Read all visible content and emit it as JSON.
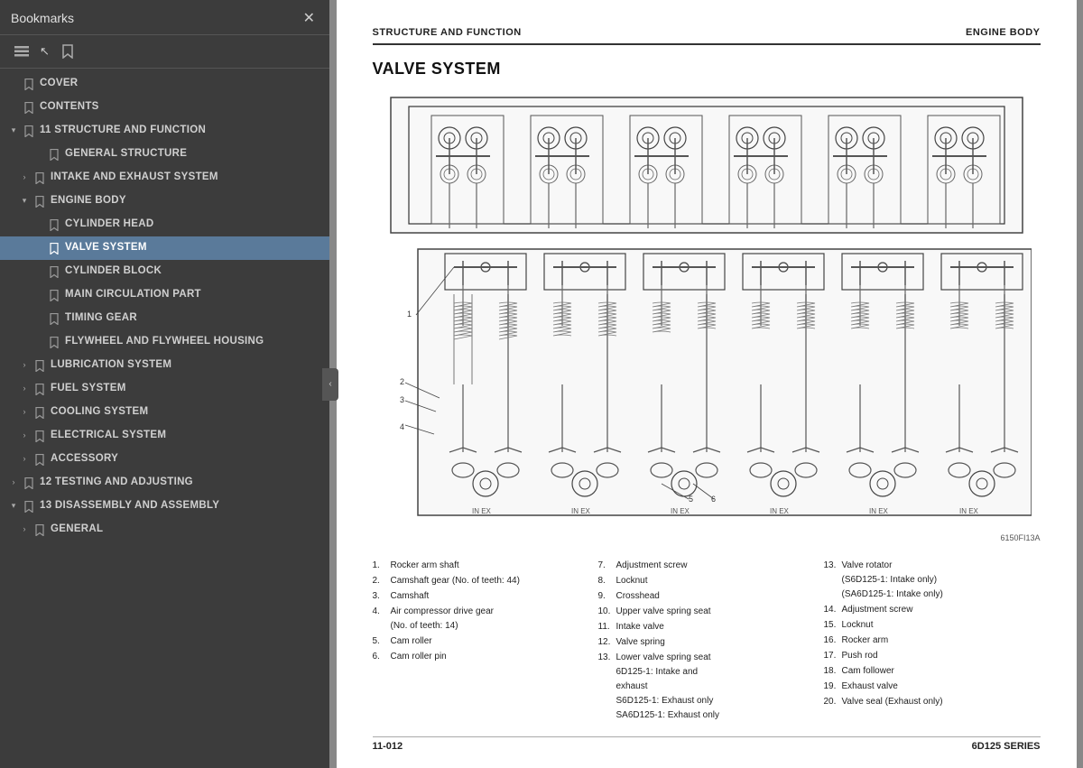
{
  "left_panel": {
    "title": "Bookmarks",
    "close_label": "✕",
    "toolbar": {
      "icon1": "☰",
      "icon2": "🔖",
      "cursor": "↖"
    },
    "tree": [
      {
        "id": "cover",
        "label": "COVER",
        "level": 0,
        "toggle": "",
        "hasBookmark": true,
        "active": false
      },
      {
        "id": "contents",
        "label": "CONTENTS",
        "level": 0,
        "toggle": "",
        "hasBookmark": true,
        "active": false
      },
      {
        "id": "struct-func",
        "label": "11 STRUCTURE AND FUNCTION",
        "level": 0,
        "toggle": "▾",
        "hasBookmark": true,
        "active": false
      },
      {
        "id": "gen-struct",
        "label": "GENERAL STRUCTURE",
        "level": 2,
        "toggle": "",
        "hasBookmark": true,
        "active": false
      },
      {
        "id": "intake-exhaust",
        "label": "INTAKE AND EXHAUST SYSTEM",
        "level": 1,
        "toggle": "›",
        "hasBookmark": true,
        "active": false
      },
      {
        "id": "engine-body",
        "label": "ENGINE BODY",
        "level": 1,
        "toggle": "▾",
        "hasBookmark": true,
        "active": false
      },
      {
        "id": "cyl-head",
        "label": "CYLINDER HEAD",
        "level": 2,
        "toggle": "",
        "hasBookmark": true,
        "active": false
      },
      {
        "id": "valve-system",
        "label": "VALVE SYSTEM",
        "level": 2,
        "toggle": "",
        "hasBookmark": true,
        "active": true
      },
      {
        "id": "cyl-block",
        "label": "CYLINDER BLOCK",
        "level": 2,
        "toggle": "",
        "hasBookmark": true,
        "active": false
      },
      {
        "id": "main-circ",
        "label": "MAIN CIRCULATION PART",
        "level": 2,
        "toggle": "",
        "hasBookmark": true,
        "active": false
      },
      {
        "id": "timing-gear",
        "label": "TIMING GEAR",
        "level": 2,
        "toggle": "",
        "hasBookmark": true,
        "active": false
      },
      {
        "id": "flywheel",
        "label": "FLYWHEEL AND FLYWHEEL HOUSING",
        "level": 2,
        "toggle": "",
        "hasBookmark": true,
        "active": false
      },
      {
        "id": "lubrication",
        "label": "LUBRICATION SYSTEM",
        "level": 1,
        "toggle": "›",
        "hasBookmark": true,
        "active": false
      },
      {
        "id": "fuel",
        "label": "FUEL SYSTEM",
        "level": 1,
        "toggle": "›",
        "hasBookmark": true,
        "active": false
      },
      {
        "id": "cooling",
        "label": "COOLING SYSTEM",
        "level": 1,
        "toggle": "›",
        "hasBookmark": true,
        "active": false
      },
      {
        "id": "electrical",
        "label": "ELECTRICAL SYSTEM",
        "level": 1,
        "toggle": "›",
        "hasBookmark": true,
        "active": false
      },
      {
        "id": "accessory",
        "label": "ACCESSORY",
        "level": 1,
        "toggle": "›",
        "hasBookmark": true,
        "active": false
      },
      {
        "id": "testing",
        "label": "12 TESTING AND ADJUSTING",
        "level": 0,
        "toggle": "›",
        "hasBookmark": true,
        "active": false
      },
      {
        "id": "disassembly",
        "label": "13 DISASSEMBLY AND ASSEMBLY",
        "level": 0,
        "toggle": "▾",
        "hasBookmark": true,
        "active": false
      },
      {
        "id": "general",
        "label": "GENERAL",
        "level": 1,
        "toggle": "›",
        "hasBookmark": true,
        "active": false
      }
    ]
  },
  "right_panel": {
    "header_left": "STRUCTURE AND FUNCTION",
    "header_right": "ENGINE BODY",
    "section_title": "VALVE SYSTEM",
    "diagram_code": "6150FI13A",
    "legend_col1": [
      {
        "num": "1.",
        "text": "Rocker arm shaft"
      },
      {
        "num": "2.",
        "text": "Camshaft gear (No. of teeth: 44)"
      },
      {
        "num": "3.",
        "text": "Camshaft"
      },
      {
        "num": "4.",
        "text": "Air compressor drive gear\n(No. of teeth: 14)"
      },
      {
        "num": "5.",
        "text": "Cam roller"
      },
      {
        "num": "6.",
        "text": "Cam roller pin"
      }
    ],
    "legend_col2": [
      {
        "num": "7.",
        "text": "Adjustment screw"
      },
      {
        "num": "8.",
        "text": "Locknut"
      },
      {
        "num": "9.",
        "text": "Crosshead"
      },
      {
        "num": "10.",
        "text": "Upper valve spring seat"
      },
      {
        "num": "11.",
        "text": "Intake valve"
      },
      {
        "num": "12.",
        "text": "Valve spring"
      },
      {
        "num": "13.",
        "text": "Lower valve spring seat\n6D125-1:  Intake and\n           exhaust\nS6D125-1: Exhaust only\nSA6D125-1: Exhaust only"
      }
    ],
    "legend_col3": [
      {
        "num": "13.",
        "text": "Valve rotator\n(S6D125-1:   Intake only)\n(SA6D125-1: Intake only)"
      },
      {
        "num": "14.",
        "text": "Adjustment screw"
      },
      {
        "num": "15.",
        "text": "Locknut"
      },
      {
        "num": "16.",
        "text": "Rocker arm"
      },
      {
        "num": "17.",
        "text": "Push rod"
      },
      {
        "num": "18.",
        "text": "Cam follower"
      },
      {
        "num": "19.",
        "text": "Exhaust valve"
      },
      {
        "num": "20.",
        "text": "Valve seal (Exhaust only)"
      }
    ],
    "page_number": "11-012",
    "series": "6D125 SERIES",
    "collapse_arrow": "‹"
  }
}
